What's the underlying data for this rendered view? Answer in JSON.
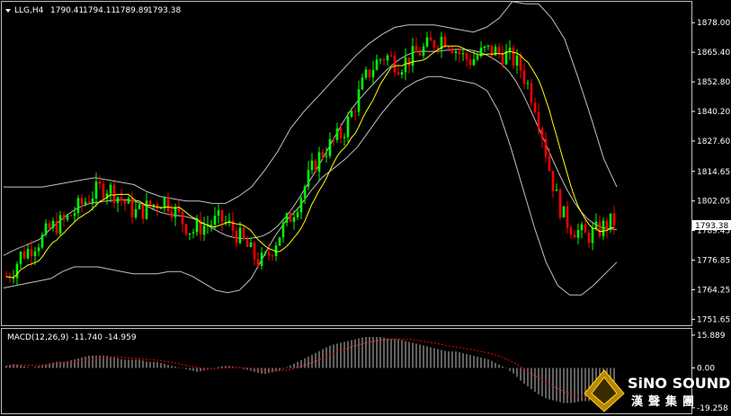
{
  "header": {
    "symbol": "LLG,H4",
    "open": "1790.41",
    "high": "1794.11",
    "low": "1789.89",
    "close": "1793.38"
  },
  "macd_label": "MACD(12,26,9) -11.740 -14.959",
  "brand": {
    "line1": "SiNO SOUND",
    "line2": "漢聲集團"
  },
  "colors": {
    "background": "#000000",
    "bull_candle": "#00ff00",
    "bear_candle": "#ff0000",
    "bollinger": "#c0c0c0",
    "moving_average": "#ffff00",
    "macd_histogram": "#c0c0c0",
    "macd_signal": "#ff0000",
    "axis": "#ffffff"
  },
  "chart_data": [
    {
      "type": "candlestick",
      "title": "LLG,H4",
      "y_ticks": [
        "1878.00",
        "1865.40",
        "1852.80",
        "1840.20",
        "1827.60",
        "1814.65",
        "1802.05",
        "1789.45",
        "1776.85",
        "1764.25",
        "1751.65"
      ],
      "y_tick_values": [
        1878.0,
        1865.4,
        1852.8,
        1840.2,
        1827.6,
        1814.65,
        1802.05,
        1789.45,
        1776.85,
        1764.25,
        1751.65
      ],
      "current_price": "1793.38",
      "ylim": [
        1749.5,
        1886.5
      ],
      "grid": false,
      "close_series": [
        1770,
        1773,
        1779,
        1781,
        1784,
        1786,
        1790,
        1792,
        1793,
        1796,
        1799,
        1802,
        1805,
        1807,
        1808,
        1806,
        1803,
        1800,
        1797,
        1798,
        1800,
        1801,
        1803,
        1800,
        1796,
        1792,
        1789,
        1791,
        1792,
        1793,
        1794,
        1792,
        1789,
        1785,
        1781,
        1777,
        1776,
        1781,
        1787,
        1792,
        1797,
        1803,
        1810,
        1817,
        1822,
        1825,
        1828,
        1831,
        1837,
        1845,
        1853,
        1858,
        1862,
        1864,
        1862,
        1860,
        1862,
        1864,
        1866,
        1868,
        1870,
        1872,
        1870,
        1866,
        1863,
        1862,
        1864,
        1866,
        1866,
        1865,
        1864,
        1862,
        1858,
        1851,
        1843,
        1830,
        1815,
        1803,
        1795,
        1791,
        1789,
        1787,
        1788,
        1790,
        1792,
        1793.38
      ],
      "bollinger_upper": [
        1808,
        1808,
        1808,
        1808,
        1809,
        1810,
        1811,
        1812,
        1811,
        1810,
        1809,
        1806,
        1804,
        1803,
        1802,
        1802,
        1801,
        1801,
        1804,
        1808,
        1815,
        1823,
        1833,
        1840,
        1846,
        1852,
        1858,
        1864,
        1869,
        1873,
        1876,
        1877,
        1877,
        1877,
        1876,
        1875,
        1874,
        1876,
        1880,
        1887,
        1886,
        1886,
        1880,
        1871,
        1855,
        1838,
        1820,
        1808
      ],
      "bollinger_lower": [
        1765,
        1766,
        1767,
        1768,
        1769,
        1772,
        1774,
        1774,
        1774,
        1773,
        1772,
        1771,
        1771,
        1771,
        1772,
        1772,
        1770,
        1767,
        1764,
        1763,
        1764,
        1769,
        1778,
        1787,
        1794,
        1799,
        1806,
        1812,
        1816,
        1820,
        1825,
        1832,
        1839,
        1845,
        1850,
        1853,
        1855,
        1855,
        1854,
        1853,
        1852,
        1849,
        1840,
        1825,
        1808,
        1791,
        1776,
        1766,
        1762,
        1762,
        1766,
        1771,
        1776
      ]
    },
    {
      "type": "bar",
      "title": "MACD(12,26,9) -11.740 -14.959",
      "y_ticks": [
        "15.889",
        "0.00",
        "-19.258"
      ],
      "y_tick_values": [
        15.889,
        0.0,
        -19.258
      ],
      "ylim": [
        -21.5,
        18.5
      ],
      "grid": false,
      "macd_value": -11.74,
      "signal_value": -14.959,
      "histogram_series": [
        1,
        2,
        1,
        0,
        1,
        2,
        3,
        3,
        4,
        5,
        6,
        6,
        6,
        5,
        4,
        4,
        4,
        3,
        3,
        2,
        1,
        0,
        -1,
        -2,
        -1,
        0,
        1,
        1,
        0,
        -1,
        -2,
        -3,
        -2,
        -1,
        1,
        3,
        5,
        7,
        9,
        11,
        12,
        13,
        14,
        15,
        15,
        15,
        14,
        14,
        13,
        12,
        11,
        10,
        9,
        8,
        8,
        7,
        6,
        5,
        4,
        2,
        0,
        -3,
        -7,
        -10,
        -13,
        -15,
        -16,
        -17,
        -17,
        -16,
        -16,
        -15,
        -14,
        -12
      ],
      "signal_series": [
        1,
        1.5,
        1.5,
        1.3,
        1.2,
        1.5,
        2,
        2.5,
        3,
        3.5,
        4,
        4.8,
        5.2,
        5.3,
        5,
        4.8,
        4.5,
        4.2,
        3.8,
        3.3,
        2.6,
        1.8,
        1,
        0.2,
        -0.3,
        -0.3,
        0,
        0.2,
        0.2,
        0,
        -0.5,
        -1.2,
        -1.5,
        -1.4,
        -0.8,
        0.2,
        1.5,
        3,
        4.8,
        6.5,
        8,
        9.5,
        10.8,
        12,
        12.8,
        13.5,
        13.9,
        14,
        14,
        13.6,
        13,
        12.3,
        11.6,
        10.8,
        10.2,
        9.5,
        8.8,
        8,
        7.2,
        6,
        4.5,
        2.5,
        0,
        -2.5,
        -5,
        -7.5,
        -9.5,
        -11.5,
        -13,
        -14,
        -14.6,
        -15,
        -15,
        -14.96
      ]
    }
  ]
}
